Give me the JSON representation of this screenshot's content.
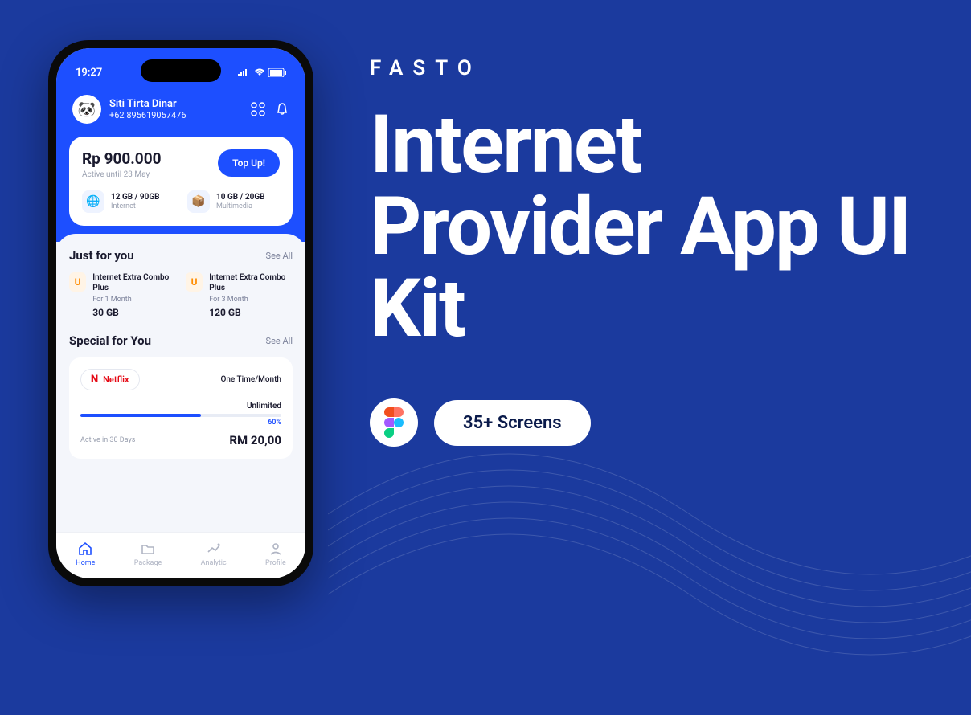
{
  "brand": "FASTO",
  "headline": "Internet Provider App UI Kit",
  "screens_badge": "35+ Screens",
  "phone": {
    "time": "19:27",
    "user": {
      "name": "Siti Tirta Dinar",
      "phone": "+62 895619057476"
    },
    "balance": {
      "amount": "Rp 900.000",
      "sub": "Active until 23 May",
      "topup": "Top Up!"
    },
    "quota": {
      "internet": {
        "value": "12 GB / 90GB",
        "label": "Internet"
      },
      "multimedia": {
        "value": "10 GB / 20GB",
        "label": "Multimedia"
      }
    },
    "justforyou": {
      "title": "Just for you",
      "see": "See All",
      "items": [
        {
          "title": "Internet Extra Combo Plus",
          "duration": "For 1 Month",
          "size": "30 GB"
        },
        {
          "title": "Internet Extra Combo Plus",
          "duration": "For 3 Month",
          "size": "120 GB"
        }
      ]
    },
    "special": {
      "title": "Special for You",
      "see": "See All",
      "brand": "Netflix",
      "period": "One Time/Month",
      "limit": "Unlimited",
      "pct": "60%",
      "active": "Active in 30 Days",
      "price": "RM 20,00"
    },
    "nav": {
      "home": "Home",
      "package": "Package",
      "analytic": "Analytic",
      "profile": "Profile"
    }
  }
}
